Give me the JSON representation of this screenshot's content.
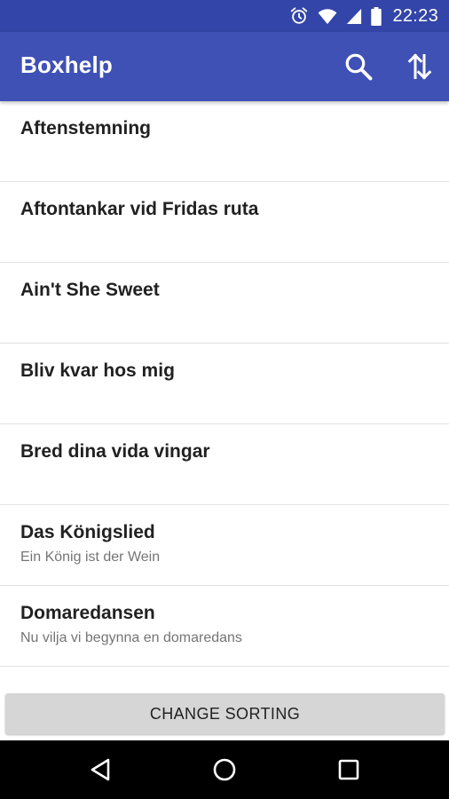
{
  "status_bar": {
    "time": "22:23",
    "icons": [
      "alarm-icon",
      "wifi-icon",
      "cell-signal-icon",
      "battery-icon"
    ]
  },
  "app_bar": {
    "title": "Boxhelp",
    "actions": [
      "search-icon",
      "sort-icon"
    ]
  },
  "songs": [
    {
      "title": "Aftenstemning",
      "subtitle": ""
    },
    {
      "title": "Aftontankar vid Fridas ruta",
      "subtitle": ""
    },
    {
      "title": "Ain't She Sweet",
      "subtitle": ""
    },
    {
      "title": "Bliv kvar hos mig",
      "subtitle": ""
    },
    {
      "title": "Bred dina vida vingar",
      "subtitle": ""
    },
    {
      "title": "Das Königslied",
      "subtitle": "Ein König ist der Wein"
    },
    {
      "title": "Domaredansen",
      "subtitle": "Nu vilja vi begynna en domaredans"
    }
  ],
  "change_sorting_label": "CHANGE SORTING",
  "nav_bar": {
    "buttons": [
      "back-icon",
      "home-icon",
      "recents-icon"
    ]
  },
  "colors": {
    "status_bar": "#3345a8",
    "app_bar": "#3f51b5",
    "button": "#d6d6d6"
  }
}
